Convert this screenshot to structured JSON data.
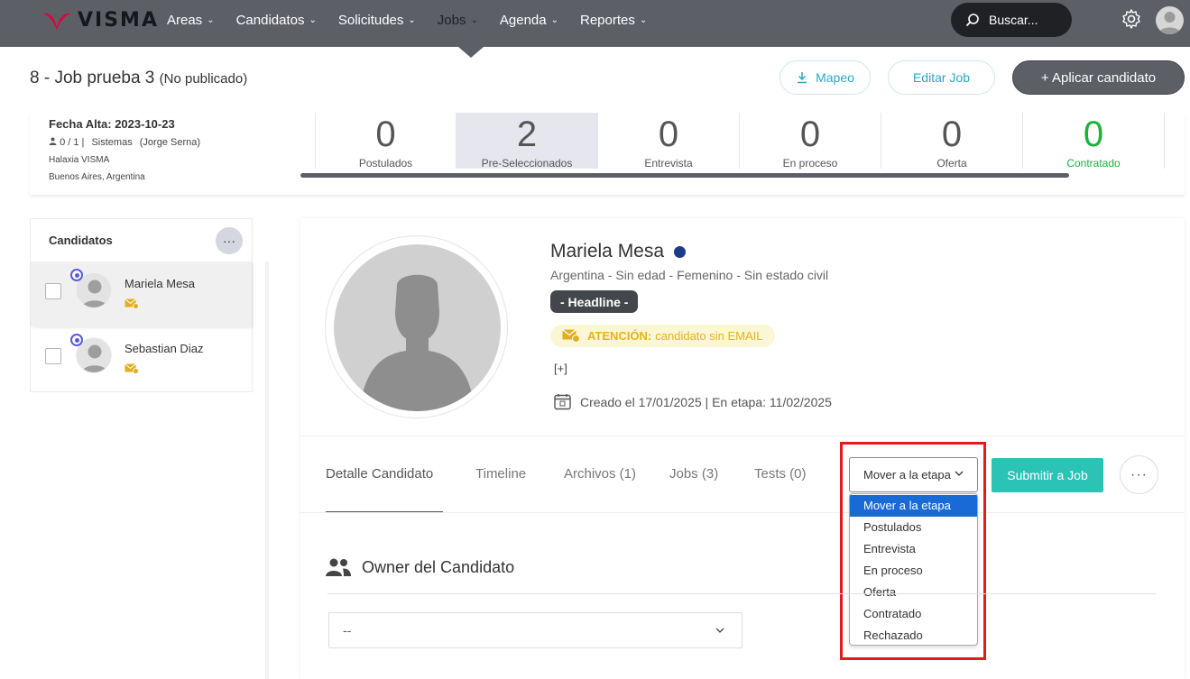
{
  "brand": {
    "name": "VISMA",
    "accent": "#e4003a"
  },
  "nav": {
    "items": [
      {
        "label": "Areas"
      },
      {
        "label": "Candidatos"
      },
      {
        "label": "Solicitudes"
      },
      {
        "label": "Jobs"
      },
      {
        "label": "Agenda"
      },
      {
        "label": "Reportes"
      }
    ],
    "active": "Jobs",
    "search_label": "Buscar..."
  },
  "header": {
    "title": "8 - Job prueba 3",
    "status": "(No publicado)",
    "mapeo_label": "Mapeo",
    "editar_label": "Editar Job",
    "aplicar_label": "+ Aplicar candidato"
  },
  "job_info": {
    "fecha_alta": "Fecha Alta: 2023-10-23",
    "counts": "0 / 1 |",
    "area": "Sistemas",
    "owner": "(Jorge Serna)",
    "company": "Halaxia VISMA",
    "location": "Buenos Aires, Argentina"
  },
  "stages": [
    {
      "count": "0",
      "label": "Postulados"
    },
    {
      "count": "2",
      "label": "Pre-Seleccionados"
    },
    {
      "count": "0",
      "label": "Entrevista"
    },
    {
      "count": "0",
      "label": "En proceso"
    },
    {
      "count": "0",
      "label": "Oferta"
    },
    {
      "count": "0",
      "label": "Contratado"
    }
  ],
  "candidates_panel": {
    "title": "Candidatos",
    "more_label": "···",
    "items": [
      {
        "name": "Mariela Mesa"
      },
      {
        "name": "Sebastian Diaz"
      }
    ]
  },
  "profile": {
    "name": "Mariela Mesa",
    "info": "Argentina - Sin edad - Femenino - Sin estado civil",
    "headline": "- Headline -",
    "attention_strong": "ATENCIÓN:",
    "attention_text": "candidato sin EMAIL",
    "expand": "[+]",
    "created": "Creado el 17/01/2025 | En etapa: 11/02/2025"
  },
  "tabs": [
    {
      "label": "Detalle Candidato"
    },
    {
      "label": "Timeline"
    },
    {
      "label": "Archivos (1)"
    },
    {
      "label": "Jobs (3)"
    },
    {
      "label": "Tests (0)"
    }
  ],
  "stage_select": {
    "value": "Mover a la etapa",
    "options": [
      "Mover a la etapa",
      "Postulados",
      "Entrevista",
      "En proceso",
      "Oferta",
      "Contratado",
      "Rechazado"
    ],
    "highlighted": "Mover a la etapa"
  },
  "submit_label": "Submitir a Job",
  "more_label": "···",
  "owner": {
    "title": "Owner del Candidato",
    "value": "--"
  }
}
